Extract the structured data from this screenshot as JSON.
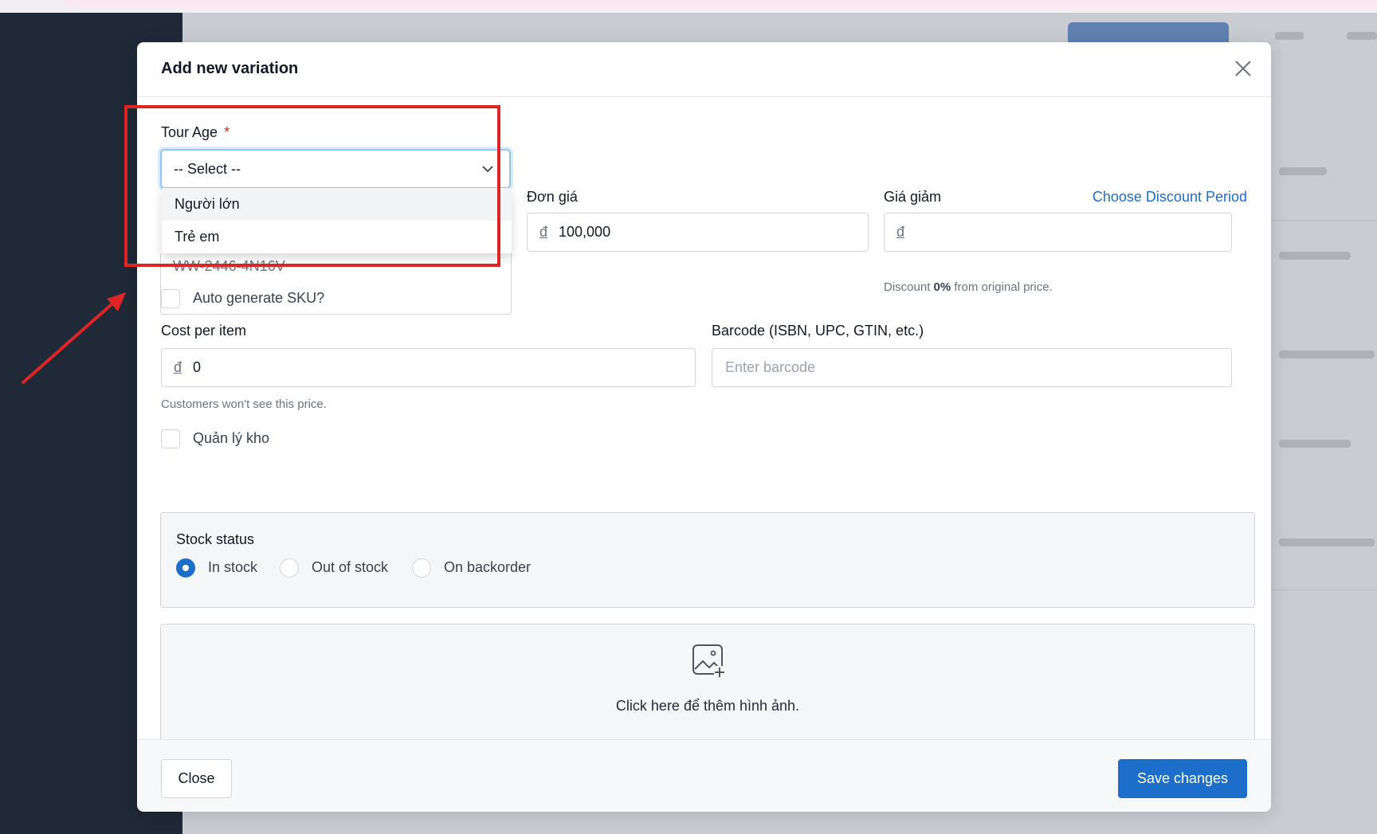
{
  "modal": {
    "title": "Add new variation"
  },
  "tour_age": {
    "label": "Tour Age",
    "required_mark": "*",
    "selected": "-- Select --",
    "options": [
      "Người lớn",
      "Trẻ em"
    ]
  },
  "sku": {
    "value_partial": "WW-2446-4N16V"
  },
  "unit_price": {
    "label": "Đơn giá",
    "currency": "đ",
    "value": "100,000"
  },
  "discount_price": {
    "label": "Giá giảm",
    "period_link": "Choose Discount Period",
    "currency": "đ",
    "value": "",
    "help_prefix": "Discount ",
    "help_percent": "0%",
    "help_suffix": " from original price."
  },
  "auto_sku": {
    "label": "Auto generate SKU?",
    "checked": false
  },
  "cost": {
    "label": "Cost per item",
    "currency": "đ",
    "value": "0",
    "help": "Customers won't see this price."
  },
  "barcode": {
    "label": "Barcode (ISBN, UPC, GTIN, etc.)",
    "placeholder": "Enter barcode"
  },
  "inventory": {
    "label": "Quản lý kho",
    "checked": false
  },
  "stock_status": {
    "label": "Stock status",
    "options": [
      "In stock",
      "Out of stock",
      "On backorder"
    ],
    "selected": "In stock"
  },
  "upload": {
    "text": "Click here để thêm hình ảnh."
  },
  "footer": {
    "close_label": "Close",
    "save_label": "Save changes"
  },
  "colors": {
    "primary": "#1d6ec9",
    "annotation_red": "#dc2626",
    "required_red": "#dc2626"
  }
}
